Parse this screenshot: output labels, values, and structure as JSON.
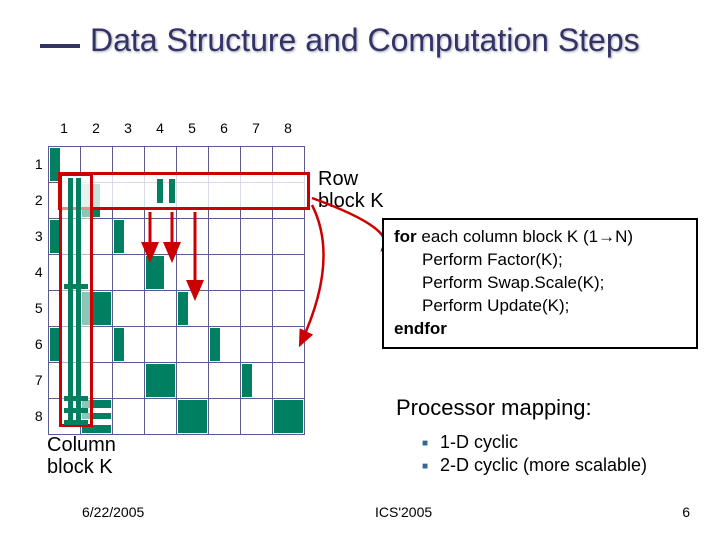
{
  "title": "Data Structure and Computation Steps",
  "matrix": {
    "col_headers": [
      "1",
      "2",
      "3",
      "4",
      "5",
      "6",
      "7",
      "8"
    ],
    "row_headers": [
      "1",
      "2",
      "3",
      "4",
      "5",
      "6",
      "7",
      "8"
    ]
  },
  "labels": {
    "row_block": "Row\nblock K",
    "col_block": "Column\nblock K"
  },
  "algorithm": {
    "line1_kw": "for",
    "line1_rest": " each column block K (1→N)",
    "line2": "Perform Factor(K);",
    "line3": "Perform Swap.Scale(K);",
    "line4": "Perform Update(K);",
    "line5_kw": "endfor"
  },
  "processor": {
    "heading": "Processor mapping:",
    "items": [
      "1-D cyclic",
      "2-D cyclic (more scalable)"
    ]
  },
  "footer": {
    "date": "6/22/2005",
    "venue": "ICS'2005",
    "page": "6"
  }
}
